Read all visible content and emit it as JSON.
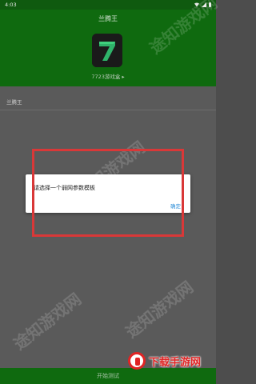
{
  "status_bar": {
    "time": "4:03"
  },
  "header": {
    "title": "兰腾王",
    "logo_icon": "seven-logo-icon",
    "subtitle": "7723游戏盒 ▸"
  },
  "content": {
    "section_label": "兰腾王"
  },
  "dialog": {
    "message": "请选择一个弱网参数模板",
    "ok_label": "确定",
    "ok_color": "#2f8fd8"
  },
  "bottom_bar": {
    "start_label": "开始测试"
  },
  "watermarks": [
    "途知游戏网",
    "途知游戏网",
    "途知游戏网",
    "途知游戏网"
  ],
  "site_logo": {
    "text": "下载手游网",
    "color": "#e02424"
  },
  "colors": {
    "primary_green": "#0f6a0f",
    "overlay_gray": "#5a5a5a",
    "annotation_red": "#d93838"
  }
}
